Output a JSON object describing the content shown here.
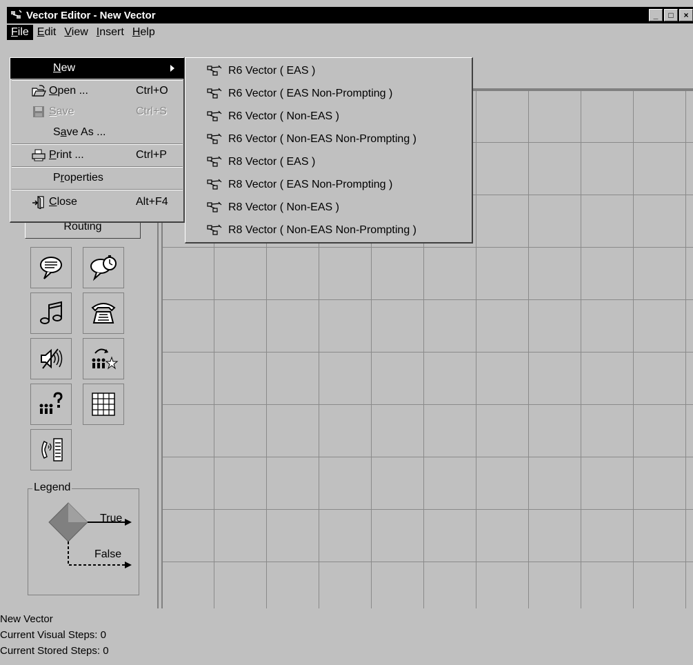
{
  "window": {
    "title": "Vector Editor - New Vector",
    "buttons": [
      "_",
      "□",
      "×"
    ]
  },
  "menubar": {
    "items": [
      {
        "label_u": "F",
        "label_rest": "ile"
      },
      {
        "label_u": "E",
        "label_rest": "dit"
      },
      {
        "label_u": "V",
        "label_rest": "iew"
      },
      {
        "label_u": "I",
        "label_rest": "nsert"
      },
      {
        "label_u": "H",
        "label_rest": "elp"
      }
    ]
  },
  "file_menu": {
    "new": {
      "label_u": "N",
      "label_rest": "ew"
    },
    "open": {
      "label_u": "O",
      "label_rest": "pen ...",
      "shortcut": "Ctrl+O"
    },
    "save": {
      "label_u": "S",
      "label_rest": "ave",
      "shortcut": "Ctrl+S"
    },
    "save_as": {
      "label_pre": "S",
      "label_u": "a",
      "label_rest": "ve As ..."
    },
    "print": {
      "label_u": "P",
      "label_rest": "rint ...",
      "shortcut": "Ctrl+P"
    },
    "properties": {
      "label_pre": "P",
      "label_u": "r",
      "label_rest": "operties"
    },
    "close": {
      "label_u": "C",
      "label_rest": "lose",
      "shortcut": "Alt+F4"
    }
  },
  "new_submenu": {
    "items": [
      "R6 Vector ( EAS )",
      "R6 Vector ( EAS Non-Prompting )",
      "R6 Vector ( Non-EAS )",
      "R6 Vector ( Non-EAS Non-Prompting )",
      "R8 Vector ( EAS )",
      "R8 Vector ( EAS Non-Prompting )",
      "R8 Vector ( Non-EAS )",
      "R8 Vector ( Non-EAS Non-Prompting )"
    ]
  },
  "left_panel": {
    "routing_label": "Routing",
    "legend": {
      "title": "Legend",
      "true_label": "True",
      "false_label": "False"
    }
  },
  "status": {
    "line1": "New Vector",
    "line2": "Current Visual Steps: 0",
    "line3": "Current Stored Steps: 0"
  }
}
